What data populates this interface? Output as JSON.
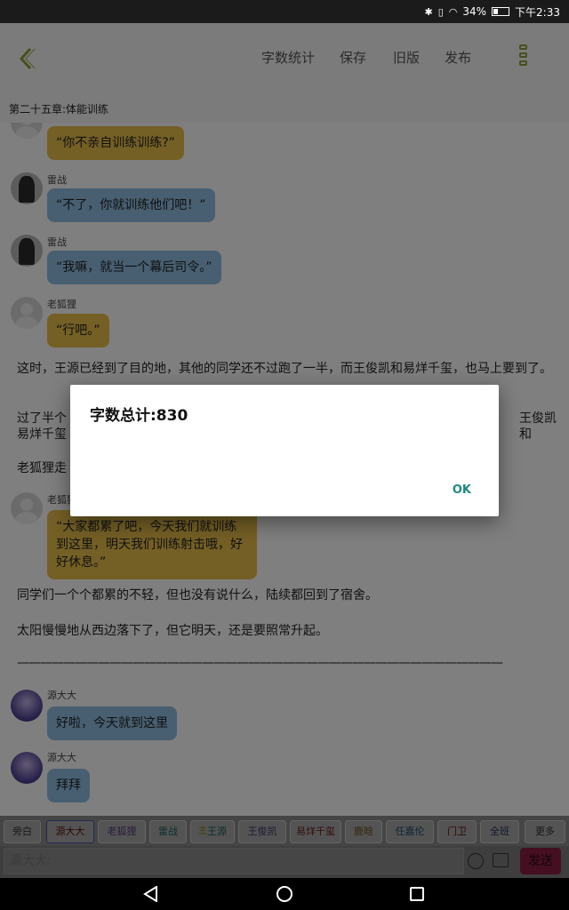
{
  "status_bar": {
    "icons": [
      "bluetooth-icon",
      "vibrate-icon",
      "wifi-icon"
    ],
    "battery": "34%",
    "battery_level": 0.34,
    "time": "下午2:33"
  },
  "toolbar": {
    "word_count": "字数统计",
    "save": "保存",
    "old_version": "旧版",
    "publish": "发布"
  },
  "chapter_title": "第二十五章:体能训练",
  "messages": [
    {
      "name": "",
      "text": "“你不亲自训练训练?”",
      "color": "yellow"
    },
    {
      "name": "雷战",
      "text": "“不了，你就训练他们吧！”",
      "color": "blue"
    },
    {
      "name": "雷战",
      "text": "“我嘛，就当一个幕后司令。”",
      "color": "blue"
    },
    {
      "name": "老狐狸",
      "text": "“行吧。”",
      "color": "yellow"
    },
    {
      "name": "老狐狸",
      "text": "“大家都累了吧，今天我们就训练到这里，明天我们训练射击哦，好好休息。”",
      "color": "yellow"
    },
    {
      "name": "源大大",
      "text": "好啦，今天就到这里",
      "color": "blue"
    },
    {
      "name": "源大大",
      "text": "拜拜",
      "color": "blue"
    }
  ],
  "narration": [
    "这时，王源已经到了目的地，其他的同学还不过跑了一半，而王俊凯和易烊千玺，也马上要到了。",
    "过了半个",
    "王俊凯和",
    "易烊千玺",
    "老狐狸走",
    "同学们一个个都累的不轻，但也没有说什么，陆续都回到了宿舍。",
    "太阳慢慢地从西边落下了，但它明天，还是要照常升起。",
    "——————————————————————————————————————————"
  ],
  "dialog": {
    "title": "字数总计:830",
    "ok": "OK"
  },
  "role_chips": [
    "旁白",
    "源大大",
    "老狐狸",
    "雷战",
    "王源",
    "王俊凯",
    "易烊千玺",
    "鹿晗",
    "任嘉伦",
    "门卫",
    "全班",
    "更多"
  ],
  "chip_badge": "主",
  "input": {
    "placeholder": "源大大:",
    "send": "发送"
  },
  "colors": {
    "accent_green": "#8aa237",
    "ok_teal": "#1f8a7d",
    "bubble_yellow": "#e8bf4b",
    "bubble_blue": "#8fbfe3",
    "send_pink": "#e0447a"
  }
}
